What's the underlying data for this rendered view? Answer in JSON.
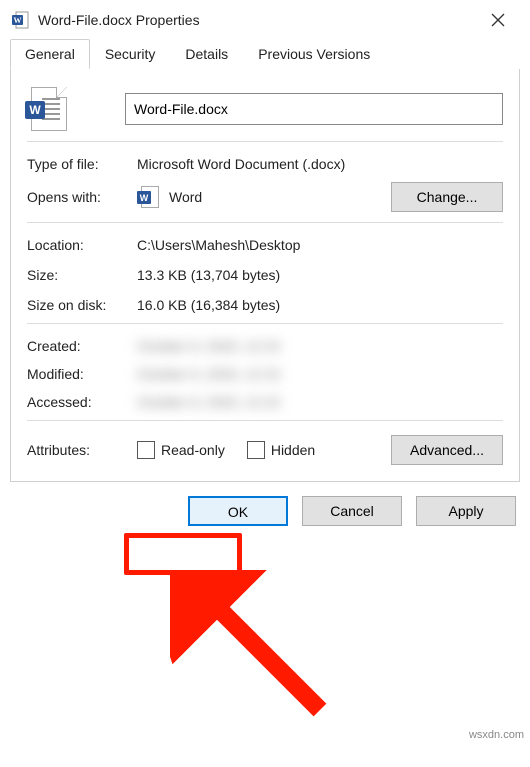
{
  "titlebar": {
    "title": "Word-File.docx Properties"
  },
  "tabs": {
    "general": "General",
    "security": "Security",
    "details": "Details",
    "previous": "Previous Versions"
  },
  "filename": "Word-File.docx",
  "fields": {
    "type_label": "Type of file:",
    "type_value": "Microsoft Word Document (.docx)",
    "opens_label": "Opens with:",
    "opens_value": "Word",
    "change_btn": "Change...",
    "location_label": "Location:",
    "location_value": "C:\\Users\\Mahesh\\Desktop",
    "size_label": "Size:",
    "size_value": "13.3 KB (13,704 bytes)",
    "disk_label": "Size on disk:",
    "disk_value": "16.0 KB (16,384 bytes)",
    "created_label": "Created:",
    "created_value": "October 9, 2020, 12:15",
    "modified_label": "Modified:",
    "modified_value": "October 9, 2020, 12:15",
    "accessed_label": "Accessed:",
    "accessed_value": "October 9, 2020, 12:15",
    "attributes_label": "Attributes:",
    "readonly_label": "Read-only",
    "hidden_label": "Hidden",
    "advanced_btn": "Advanced..."
  },
  "footer": {
    "ok": "OK",
    "cancel": "Cancel",
    "apply": "Apply"
  },
  "watermark": "wsxdn.com"
}
